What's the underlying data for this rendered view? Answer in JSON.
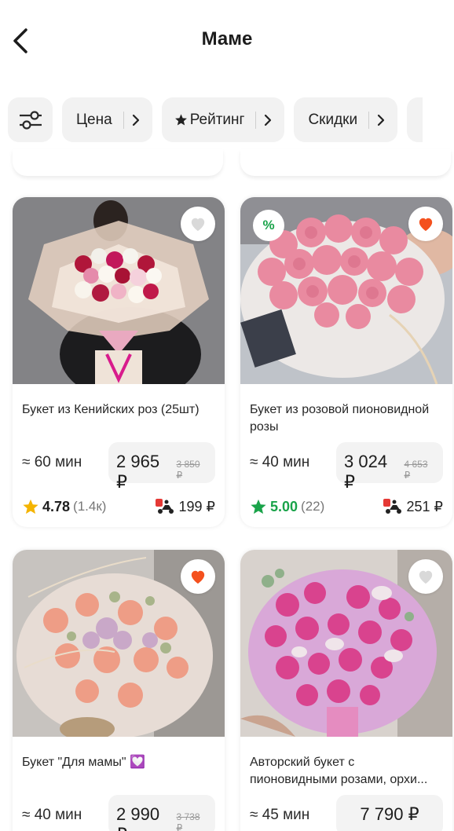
{
  "header": {
    "title": "Маме"
  },
  "filters": [
    {
      "label": "Цена",
      "star": false
    },
    {
      "label": "Рейтинг",
      "star": true
    },
    {
      "label": "Скидки",
      "star": false
    }
  ],
  "colors": {
    "star_gold": "#f4b400",
    "star_green": "#1aa34a",
    "heart_red": "#f4511e",
    "heart_empty": "#d9d9d9"
  },
  "products": [
    {
      "name": "Букет из Кенийских роз (25шт)",
      "time": "≈ 60 мин",
      "price": "2 965 ₽",
      "old_price": "3 850 ₽",
      "rating": "4.78",
      "reviews": "(1.4к)",
      "delivery": "199 ₽",
      "favorite": false,
      "discount_badge": ""
    },
    {
      "name": "Букет из розовой пионовидной розы",
      "time": "≈ 40 мин",
      "price": "3 024 ₽",
      "old_price": "4 653 ₽",
      "rating": "5.00",
      "reviews": "(22)",
      "delivery": "251 ₽",
      "favorite": true,
      "discount_badge": "%"
    },
    {
      "name": "Букет \"Для мамы\" 💟",
      "time": "≈ 40 мин",
      "price": "2 990 ₽",
      "old_price": "3 738 ₽",
      "favorite": true
    },
    {
      "name": "Авторский букет с пионовидными розами, орхи...",
      "time": "≈ 45 мин",
      "price": "7 790 ₽",
      "old_price": "",
      "favorite": false
    }
  ]
}
